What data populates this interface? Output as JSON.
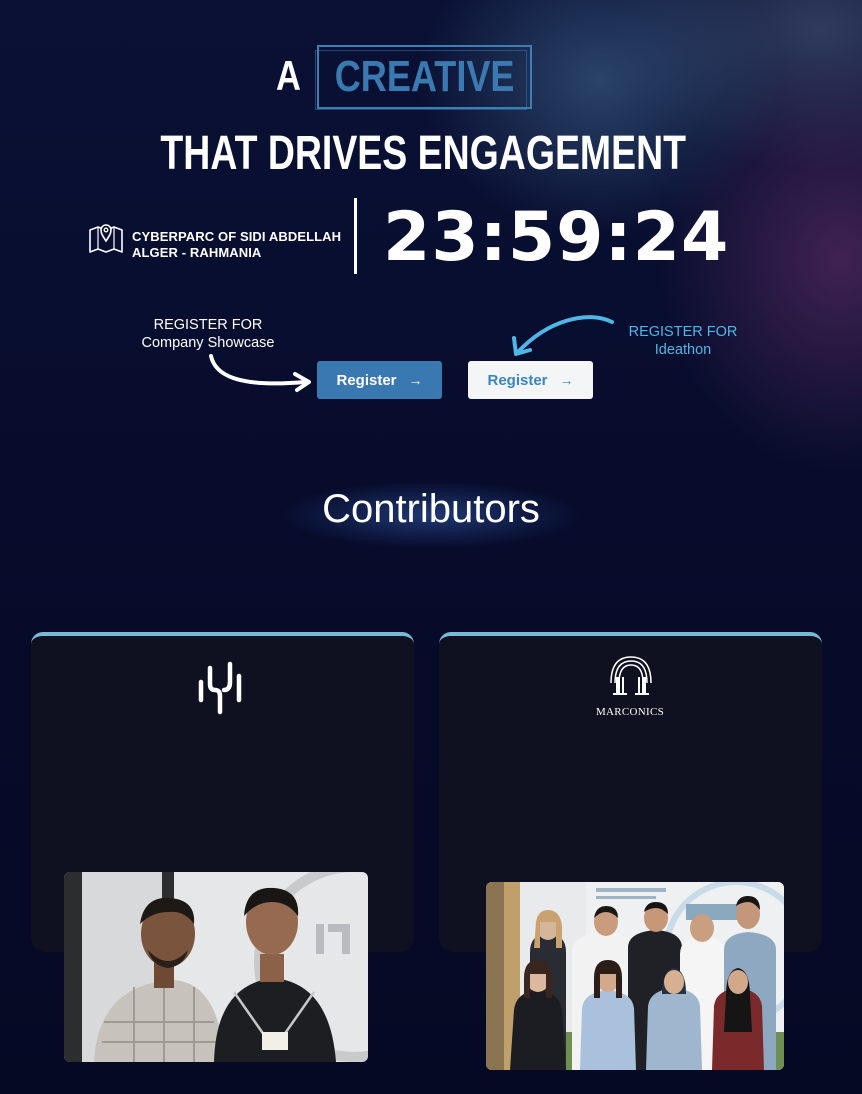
{
  "hero": {
    "word_a": "A",
    "word_creative": "CREATIVE",
    "line2": "THAT DRIVES ENGAGEMENT",
    "location_line1": "CYBERPARC OF SIDI ABDELLAH",
    "location_line2": "ALGER - RAHMANIA",
    "countdown": "23:59:24"
  },
  "register": {
    "showcase_note_line1": "REGISTER FOR",
    "showcase_note_line2": "Company Showcase",
    "ideathon_note_line1": "REGISTER FOR",
    "ideathon_note_line2": "Ideathon",
    "showcase_button": "Register",
    "ideathon_button": "Register",
    "arrow_glyph": "→"
  },
  "contributors": {
    "title": "Contributors",
    "cards": [
      {
        "logo_icon": "waveform-logo-icon",
        "logo_text": ""
      },
      {
        "logo_icon": "arch-logo-icon",
        "logo_text": "MARCONICS"
      }
    ]
  },
  "colors": {
    "accent_blue": "#3a78b2",
    "note_blue": "#4fb6e6",
    "card_bg": "#0f1120",
    "card_border": "#78b9d8",
    "background": "#060a24"
  }
}
